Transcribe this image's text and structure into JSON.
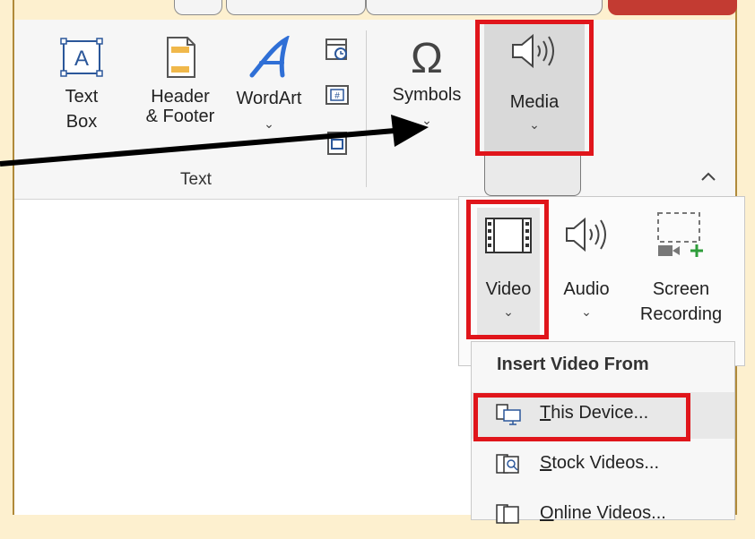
{
  "ribbon": {
    "tools": [
      {
        "name": "text-box",
        "label1": "Text",
        "label2": "Box"
      },
      {
        "name": "header-footer",
        "label1": "Header",
        "label2": "& Footer"
      },
      {
        "name": "wordart",
        "label1": "WordArt",
        "label2": "⌄"
      }
    ],
    "text_group_label": "Text",
    "symbols": {
      "label": "Symbols",
      "chevron": "⌄"
    },
    "media": {
      "label": "Media",
      "chevron": "⌄"
    },
    "collapse": "^"
  },
  "media_panel": {
    "video": {
      "label": "Video",
      "chevron": "⌄"
    },
    "audio": {
      "label": "Audio",
      "chevron": "⌄"
    },
    "screen": {
      "label1": "Screen",
      "label2": "Recording"
    }
  },
  "video_menu": {
    "heading": "Insert Video From",
    "items": [
      {
        "icon": "monitor-video-icon",
        "underline": "T",
        "rest": "his Device..."
      },
      {
        "icon": "stock-video-icon",
        "underline": "S",
        "rest": "tock Videos..."
      },
      {
        "icon": "online-video-icon",
        "underline": "O",
        "rest": "nline Videos..."
      }
    ]
  },
  "colors": {
    "accent_red": "#e0151b",
    "icon_blue": "#2b579a",
    "wordart_blue": "#2f6fd6",
    "green": "#2e9d3a"
  }
}
